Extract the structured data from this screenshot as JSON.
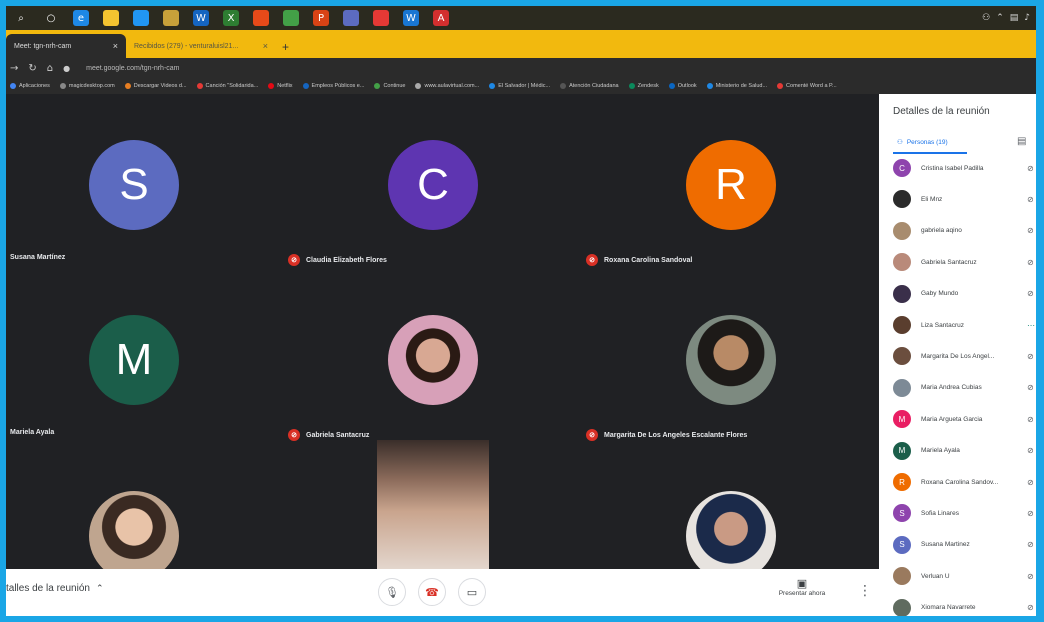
{
  "browser": {
    "tabs": [
      {
        "label": "Meet: tgn-nrh-cam"
      },
      {
        "label": "Recibidos (279) - venturaluisl21..."
      }
    ],
    "url": "meet.google.com/tgn-nrh-cam",
    "bookmarks": [
      "Aplicaciones",
      "magicdesktop.com",
      "Descargar Videos d...",
      "Canción \"Solidarida...",
      "Netflix",
      "Empleos Públicos e...",
      "Continue",
      "www.aulavirtual.com...",
      "El Salvador | Médic...",
      "Atención Ciudadana",
      "Zendesk",
      "Outlook",
      "Ministerio de Salud...",
      "Comenté Word a P..."
    ]
  },
  "tiles": [
    {
      "name": "Susana Martínez",
      "initial": "S",
      "color": "#5c6bc0"
    },
    {
      "name": "Claudia Elizabeth Flores",
      "initial": "C",
      "color": "#5e35b1"
    },
    {
      "name": "Roxana Carolina Sandoval",
      "initial": "R",
      "color": "#ef6c00"
    },
    {
      "name": "Mariela Ayala",
      "initial": "M",
      "color": "#1b5e4a"
    },
    {
      "name": "Gabriela Santacruz"
    },
    {
      "name": "Margarita De Los Angeles Escalante Flores"
    }
  ],
  "bottom_bar": {
    "details_label": "talles de la reunión",
    "present_label": "Presentar ahora"
  },
  "panel": {
    "title": "Detalles de la reunión",
    "people_tab": "Personas (19)",
    "people": [
      {
        "name": "Cristina Isabel Padilla",
        "initial": "C",
        "color": "#8e44ad"
      },
      {
        "name": "Eli Mnz",
        "initial": "",
        "color": "#2b2b2b"
      },
      {
        "name": "gabriela aqino",
        "initial": "",
        "color": "#a88c6e"
      },
      {
        "name": "Gabriela Santacruz",
        "initial": "",
        "color": "#b98a7a"
      },
      {
        "name": "Gaby Mundo",
        "initial": "",
        "color": "#3a2f4a"
      },
      {
        "name": "Liza Santacruz",
        "initial": "",
        "color": "#5a3e2e"
      },
      {
        "name": "Margarita De Los Angel...",
        "initial": "",
        "color": "#6b4e3e"
      },
      {
        "name": "Maria Andrea Cubias",
        "initial": "",
        "color": "#7d8a96"
      },
      {
        "name": "Maria Argueta Garcia",
        "initial": "M",
        "color": "#e91e63"
      },
      {
        "name": "Mariela Ayala",
        "initial": "M",
        "color": "#1b5e4a"
      },
      {
        "name": "Roxana Carolina Sandov...",
        "initial": "R",
        "color": "#ef6c00"
      },
      {
        "name": "Sofia Linares",
        "initial": "S",
        "color": "#8e44ad"
      },
      {
        "name": "Susana Martinez",
        "initial": "S",
        "color": "#5c6bc0"
      },
      {
        "name": "Verluan U",
        "initial": "",
        "color": "#9a7a5e"
      },
      {
        "name": "Xiomara Navarrete",
        "initial": "",
        "color": "#5f6b5f"
      }
    ]
  }
}
